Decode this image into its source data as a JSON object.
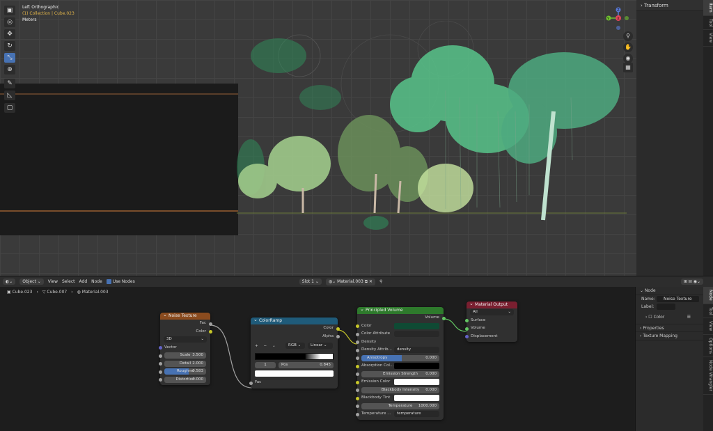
{
  "viewport": {
    "title": "Left Orthographic",
    "collection": "(1) Collection | Cube.023",
    "units": "Meters",
    "tools": [
      "select-icon",
      "cursor-icon",
      "move-icon",
      "rotate-icon",
      "scale-icon",
      "transform-icon",
      "annotate-icon",
      "measure-icon",
      "add-cube-icon"
    ],
    "nav_axes": {
      "x": "X",
      "y": "Y",
      "z": "Z"
    }
  },
  "npanel_top": {
    "section": "Transform",
    "tabs": [
      "Item",
      "Tool",
      "View"
    ]
  },
  "node_header": {
    "editor_type": "Object",
    "menus": [
      "View",
      "Select",
      "Add",
      "Node"
    ],
    "use_nodes_label": "Use Nodes",
    "slot": "Slot 1",
    "material": "Material.003"
  },
  "breadcrumb": [
    "Cube.023",
    "Cube.007",
    "Material.003"
  ],
  "nodes": {
    "noise": {
      "title": "Noise Texture",
      "out_fac": "Fac",
      "out_color": "Color",
      "dimensions": "3D",
      "vector": "Vector",
      "scale_label": "Scale",
      "scale_value": "3.500",
      "detail_label": "Detail",
      "detail_value": "2.000",
      "roughness_label": "Roughne",
      "roughness_value": "0.583",
      "distortion_label": "Distortion",
      "distortion_value": "0.000"
    },
    "colorramp": {
      "title": "ColorRamp",
      "out_color": "Color",
      "out_alpha": "Alpha",
      "color_mode": "RGB",
      "interp": "Linear",
      "stop_index": "1",
      "pos_label": "Pos",
      "pos_value": "0.845",
      "in_fac": "Fac"
    },
    "volume": {
      "title": "Principled Volume",
      "out_volume": "Volume",
      "color_label": "Color",
      "color_swatch": "#0f4a34",
      "color_attr_label": "Color Attribute",
      "density_label": "Density",
      "density_attr_label": "Density Attrib...",
      "density_attr_value": "density",
      "anisotropy_label": "Anisotropy",
      "anisotropy_value": "0.000",
      "absorption_label": "Absorption Col...",
      "emission_strength_label": "Emission Strength",
      "emission_strength_value": "0.000",
      "emission_color_label": "Emission Color",
      "blackbody_label": "Blackbody Intensity",
      "blackbody_value": "0.000",
      "blackbody_tint_label": "Blackbody Tint",
      "temperature_label": "Temperature",
      "temperature_value": "1000.000",
      "temp_attr_label": "Temperature ...",
      "temp_attr_value": "temperature"
    },
    "output": {
      "title": "Material Output",
      "target": "All",
      "surface": "Surface",
      "volume": "Volume",
      "displacement": "Displacement"
    }
  },
  "side_bottom": {
    "section_node": "Node",
    "name_label": "Name:",
    "name_value": "Noise Texture",
    "label_label": "Label:",
    "color_label": "Color",
    "properties_label": "Properties",
    "texture_mapping_label": "Texture Mapping",
    "tabs": [
      "Node",
      "Tool",
      "View",
      "Options",
      "Node Wrangler"
    ]
  },
  "colors": {
    "noise_header": "#8a4b1e",
    "colorramp_header": "#1f5b7a",
    "volume_header": "#2e7a2c",
    "output_header": "#7a1f30",
    "accent": "#4772b3"
  }
}
